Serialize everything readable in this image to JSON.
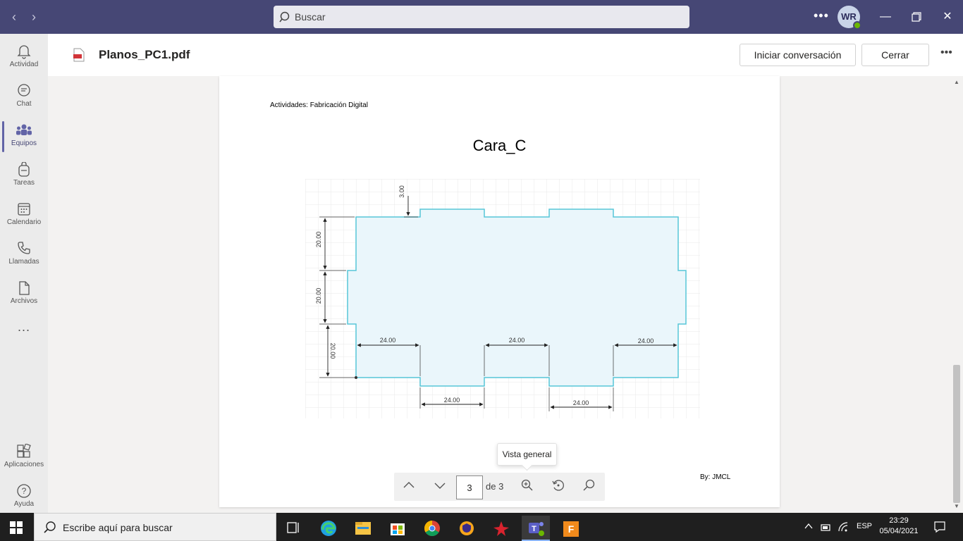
{
  "topbar": {
    "search_placeholder": "Buscar",
    "avatar_initials": "WR"
  },
  "rail": {
    "items": [
      {
        "label": "Actividad",
        "icon": "bell-icon"
      },
      {
        "label": "Chat",
        "icon": "chat-icon"
      },
      {
        "label": "Equipos",
        "icon": "teams-icon",
        "active": true
      },
      {
        "label": "Tareas",
        "icon": "backpack-icon"
      },
      {
        "label": "Calendario",
        "icon": "calendar-icon"
      },
      {
        "label": "Llamadas",
        "icon": "phone-icon"
      },
      {
        "label": "Archivos",
        "icon": "file-icon"
      }
    ],
    "more": "...",
    "bottom": [
      {
        "label": "Aplicaciones",
        "icon": "apps-icon"
      },
      {
        "label": "Ayuda",
        "icon": "help-icon"
      }
    ]
  },
  "header": {
    "file_name": "Planos_PC1.pdf",
    "start_conversation": "Iniciar conversación",
    "close": "Cerrar"
  },
  "page": {
    "header_text": "Actividades: Fabricación Digital",
    "title": "Cara_C",
    "footer_text": "By: JMCL",
    "dimensions": {
      "top_notch": "3.00",
      "left_1": "20.00",
      "left_2": "20.00",
      "left_3": "20.00",
      "inner_1": "24.00",
      "inner_2": "24.00",
      "inner_3": "24.00",
      "bottom_1": "24.00",
      "bottom_2": "24.00"
    }
  },
  "viewer": {
    "tooltip": "Vista general",
    "current_page": "3",
    "of_pages": "de 3"
  },
  "taskbar": {
    "search_text": "Escribe aquí para buscar",
    "language": "ESP",
    "time": "23:29",
    "date": "05/04/2021"
  },
  "colors": {
    "teams_purple": "#464775",
    "accent": "#6264a7",
    "shape_stroke": "#57c6d8",
    "shape_fill": "#eaf6fb"
  }
}
